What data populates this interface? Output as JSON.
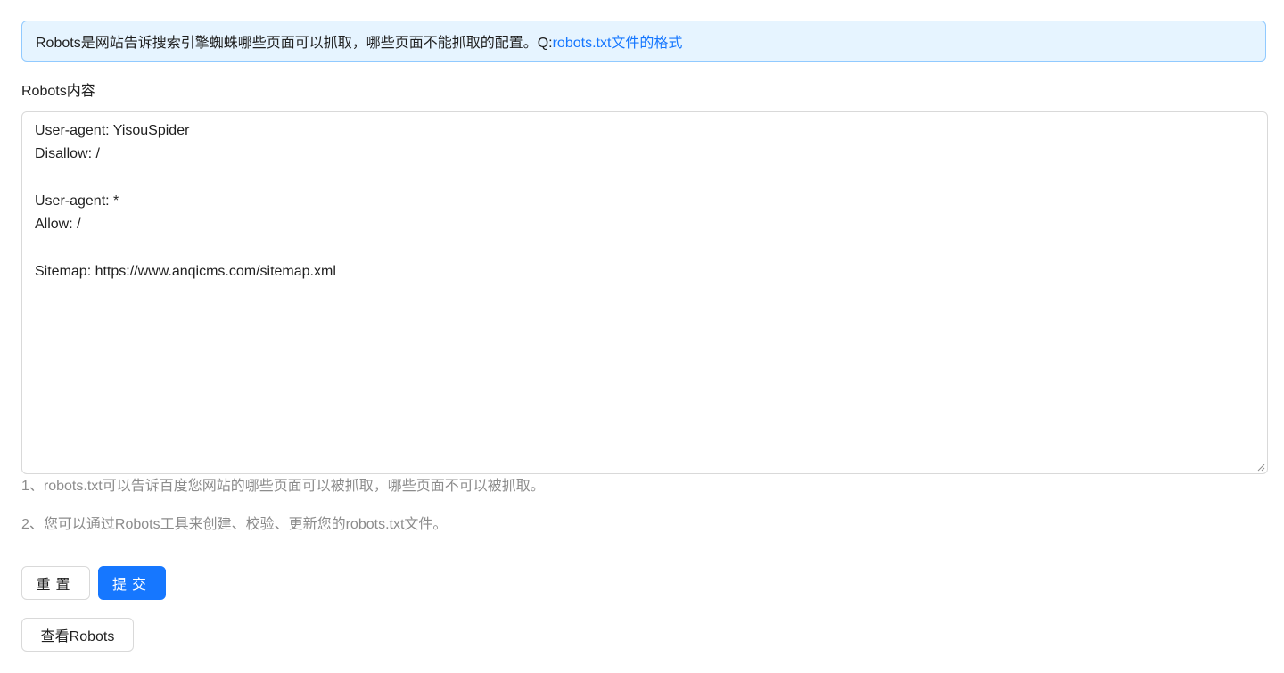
{
  "alert": {
    "text": "Robots是网站告诉搜索引擎蜘蛛哪些页面可以抓取，哪些页面不能抓取的配置。Q:",
    "link_text": "robots.txt文件的格式"
  },
  "form": {
    "label": "Robots内容",
    "content": "User-agent: YisouSpider\nDisallow: /\n\nUser-agent: *\nAllow: /\n\nSitemap: https://www.anqicms.com/sitemap.xml",
    "hints": [
      "1、robots.txt可以告诉百度您网站的哪些页面可以被抓取，哪些页面不可以被抓取。",
      "2、您可以通过Robots工具来创建、校验、更新您的robots.txt文件。"
    ]
  },
  "buttons": {
    "reset": "重置",
    "submit": "提交",
    "view": "查看Robots"
  },
  "colors": {
    "primary": "#1677ff",
    "alert_bg": "#e6f4ff",
    "alert_border": "#91caff",
    "hint": "#8c8c8c"
  }
}
